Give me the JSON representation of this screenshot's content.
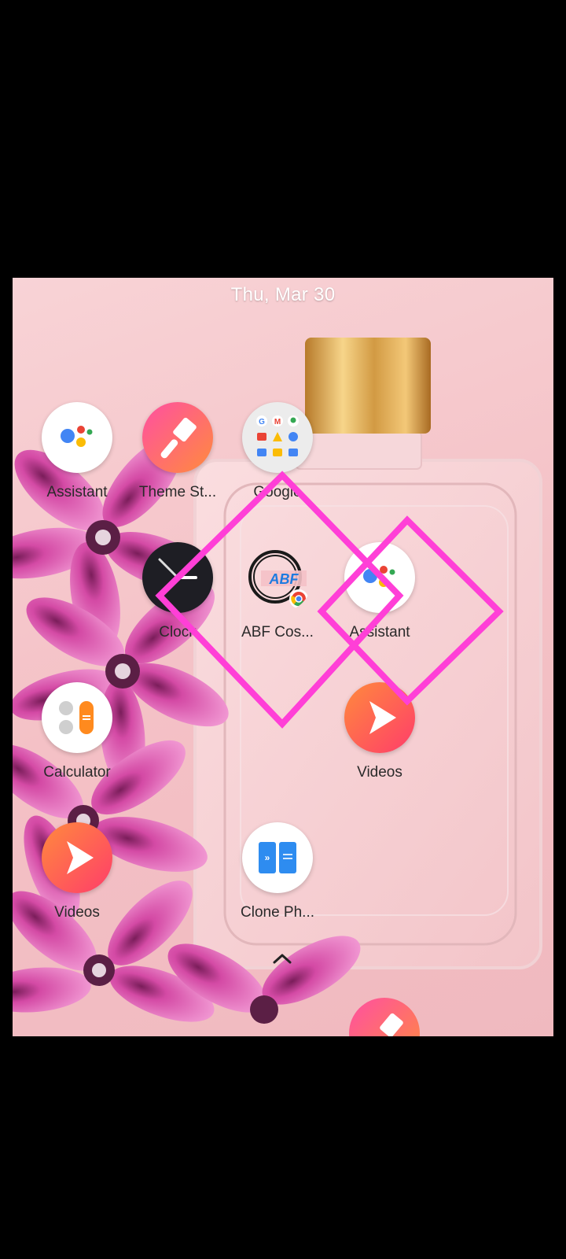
{
  "status": {
    "date": "Thu, Mar 30"
  },
  "apps": [
    {
      "label": "Assistant",
      "icon": "google-assistant-icon"
    },
    {
      "label": "Theme St...",
      "icon": "theme-brush-icon"
    },
    {
      "label": "Google",
      "icon": "google-folder-icon"
    },
    {
      "label": "Clock",
      "icon": "clock-icon"
    },
    {
      "label": "ABF Cos...",
      "icon": "abf-chrome-shortcut-icon"
    },
    {
      "label": "Assistant",
      "icon": "google-assistant-icon"
    },
    {
      "label": "Calculator",
      "icon": "calculator-icon"
    },
    {
      "label": "Videos",
      "icon": "videos-play-icon"
    },
    {
      "label": "Videos",
      "icon": "videos-play-icon"
    },
    {
      "label": "Clone Ph...",
      "icon": "clone-phone-icon"
    }
  ],
  "colors": {
    "wallpaper": "#f4c1c6",
    "highlight_diamond": "#ff3fd7",
    "videos_gradient_start": "#ff8a3d",
    "videos_gradient_end": "#ff3d6a",
    "theme_gradient_start": "#ff4fa2",
    "theme_gradient_end": "#ff8b3d"
  }
}
